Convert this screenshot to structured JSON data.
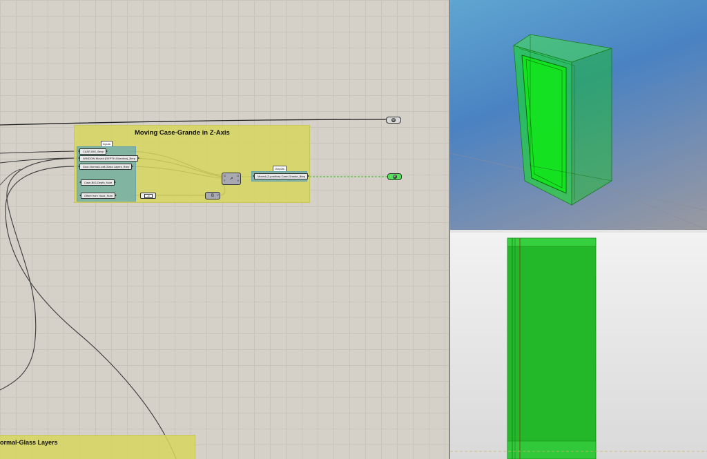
{
  "canvas": {
    "groups": [
      {
        "title": "Moving Case-Grande in Z-Axis",
        "inputs_tag": "Inputs",
        "outputs_tag": "Outputs",
        "inputs": [
          "CASE-BIG_Brep",
          "WINDOW-Moved (DEPTH-Direction)_Brep",
          "Door-Normal-Leaf-Glass Layers_Brep",
          "Case-BIG-Depth_Num",
          "Offset from Hood_Num"
        ],
        "output": "Moved (Z-position) Case-Grande_Brep",
        "move_component": {
          "glyph": "↗",
          "ports_in": [
            "G",
            "T"
          ],
          "ports_out": [
            "G",
            "X"
          ]
        },
        "multiply_component": {
          "glyph": "B",
          "port_out": "Y"
        },
        "slider_value": "+6"
      },
      {
        "title": "ormal-Glass Layers"
      }
    ],
    "relays": [
      {
        "glyph": "⊘",
        "color": "#d9d9d9"
      },
      {
        "glyph": "⊘",
        "color": "#58e05a"
      }
    ]
  },
  "viewports": {
    "colors": {
      "glass": "#11e51a",
      "glass_front": "#22b82a",
      "edge": "#1a7a1a",
      "persp_bg_top": "#5fa6d1",
      "front_bg": "#f2f2f2"
    }
  }
}
